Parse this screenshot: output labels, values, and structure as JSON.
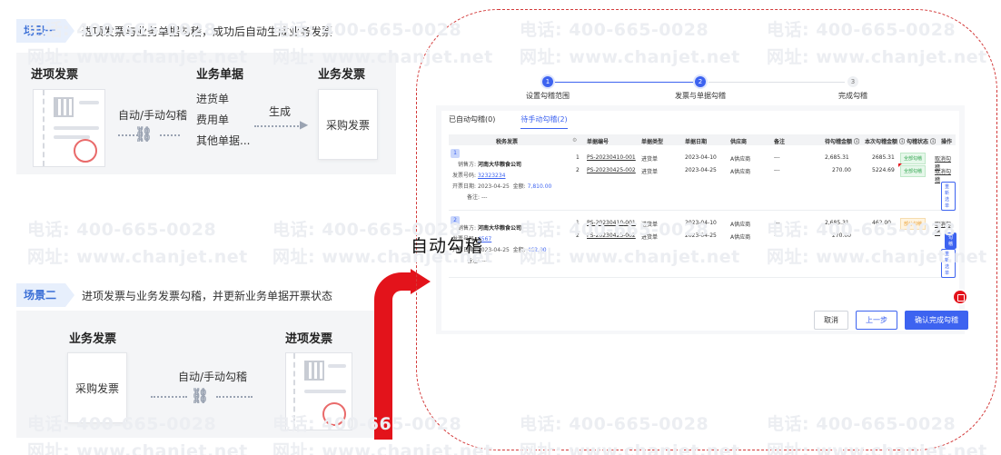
{
  "watermarks": [
    "电话: 400-665-0028",
    "网址: www.chanjet.net"
  ],
  "scene1": {
    "tag": "场景一",
    "desc": "进项发票与业务单据勾稽，成功后自动生成业务发票",
    "col_input_invoice": "进项发票",
    "col_business_docs": "业务单据",
    "col_business_invoice": "业务发票",
    "auto_label": "自动/手动勾稽",
    "docs": [
      "进货单",
      "费用单",
      "其他单据..."
    ],
    "generate_label": "生成",
    "purchase_invoice": "采购发票"
  },
  "scene2": {
    "tag": "场景二",
    "desc": "进项发票与业务发票勾稽，并更新业务单据开票状态",
    "col_business_invoice": "业务发票",
    "col_input_invoice": "进项发票",
    "purchase_invoice": "采购发票",
    "auto_label": "自动/手动勾稽"
  },
  "overlay_text": "自动勾稽",
  "app": {
    "steps": [
      {
        "num": "1",
        "label": "设置勾稽范围"
      },
      {
        "num": "2",
        "label": "发票与单据勾稽"
      },
      {
        "num": "3",
        "label": "完成勾稽"
      }
    ],
    "tabs": [
      "已自动勾稽(0)",
      "待手动勾稽(2)"
    ],
    "headers": {
      "tax_invoice": "税务发票",
      "doc_no": "单据编号",
      "doc_type": "单据类型",
      "doc_date": "单据日期",
      "supplier": "供应商",
      "note": "备注",
      "pending_amount": "待勾稽金额 ⓘ",
      "current_amount": "本次勾稽金额 ⓘ",
      "status": "勾稽状态 ⓘ",
      "op": "操作"
    },
    "groups": [
      {
        "idx": "1",
        "seller_label": "销售方:",
        "seller": "河南大华粮食公司",
        "invoice_no_label": "发票号码:",
        "invoice_no": "32323234",
        "date_label": "开票日期:",
        "date": "2023-04-25",
        "amount_label": "金额:",
        "amount": "7,810.00",
        "note_label": "备注:",
        "note": "---",
        "rows": [
          {
            "n": "1",
            "doc_no": "PS-20230410-001",
            "type": "进货单",
            "date": "2023-04-10",
            "supplier": "A供应商",
            "note": "---",
            "pending": "2,685.31",
            "current": "2685.31",
            "status": "全部勾稽",
            "op": "取消勾稽"
          },
          {
            "n": "2",
            "doc_no": "PS-20230425-002",
            "type": "进货单",
            "date": "2023-04-25",
            "supplier": "A供应商",
            "note": "---",
            "pending": "270.00",
            "current": "5224.69",
            "status": "全部勾稽",
            "op": "取消勾稽"
          }
        ],
        "reselect": "重新选单"
      },
      {
        "idx": "2",
        "seller_label": "销售方:",
        "seller": "河南大华粮食公司",
        "invoice_no_label": "发票号码:",
        "invoice_no": "4567",
        "date_label": "开票日期:",
        "date": "2023-04-25",
        "amount_label": "金额:",
        "amount": "462.00",
        "note_label": "备注:",
        "note": "---",
        "rows": [
          {
            "n": "1",
            "doc_no": "PS-20230410-001",
            "type": "进货单",
            "date": "2023-04-10",
            "supplier": "A供应商",
            "note": "---",
            "pending": "2,685.31",
            "current": "462.00",
            "status": "部分勾稽",
            "op": "取消勾稽"
          },
          {
            "n": "2",
            "doc_no": "PS-20230425-002",
            "type": "进货单",
            "date": "2023-04-25",
            "supplier": "A供应商",
            "note": "---",
            "pending": "270.00",
            "current": "",
            "status": "",
            "op": "勾稽"
          }
        ],
        "reselect": "重新选单"
      }
    ],
    "buttons": {
      "cancel": "取消",
      "prev": "上一步",
      "confirm": "确认完成勾稽"
    }
  },
  "colors": {
    "accent": "#3d63f0",
    "red": "#e3131b",
    "scene_tag_bg": "#e7effc"
  }
}
